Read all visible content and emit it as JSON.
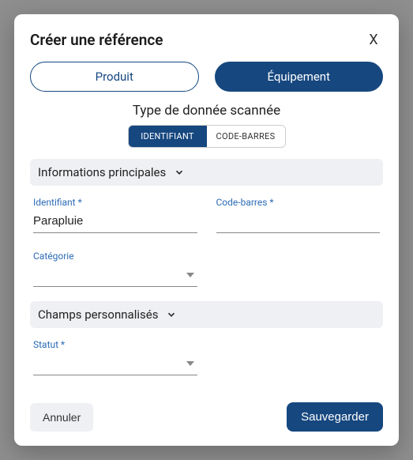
{
  "modal": {
    "title": "Créer une référence",
    "close_label": "X"
  },
  "type_toggle": {
    "product": "Produit",
    "equipment": "Équipement"
  },
  "scanned": {
    "label": "Type de donnée scannée",
    "identifier": "IDENTIFIANT",
    "barcode": "CODE-BARRES"
  },
  "sections": {
    "main_info": "Informations principales",
    "custom_fields": "Champs personnalisés"
  },
  "fields": {
    "identifier": {
      "label": "Identifiant *",
      "value": "Parapluie"
    },
    "barcode": {
      "label": "Code-barres *",
      "value": ""
    },
    "category": {
      "label": "Catégorie",
      "value": ""
    },
    "status": {
      "label": "Statut *",
      "value": ""
    }
  },
  "footer": {
    "cancel": "Annuler",
    "save": "Sauvegarder"
  },
  "colors": {
    "primary": "#16477f",
    "field_label": "#2d6bb5",
    "section_bg": "#eef0f3"
  }
}
